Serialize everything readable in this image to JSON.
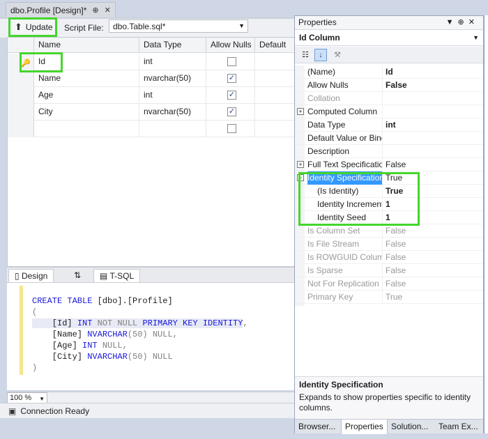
{
  "document_tab": {
    "title": "dbo.Profile [Design]*",
    "pin": "⊕",
    "close": "✕"
  },
  "toolbar": {
    "update_label": "Update",
    "script_file_label": "Script File:",
    "script_file_value": "dbo.Table.sql*"
  },
  "grid": {
    "headers": [
      "Name",
      "Data Type",
      "Allow Nulls",
      "Default"
    ],
    "rows": [
      {
        "name": "Id",
        "type": "int",
        "allow_nulls": false,
        "key": true
      },
      {
        "name": "Name",
        "type": "nvarchar(50)",
        "allow_nulls": true
      },
      {
        "name": "Age",
        "type": "int",
        "allow_nulls": true
      },
      {
        "name": "City",
        "type": "nvarchar(50)",
        "allow_nulls": true
      },
      {
        "name": "",
        "type": "",
        "allow_nulls": false
      }
    ]
  },
  "pane_tabs": {
    "design": "Design",
    "swap": "⇅",
    "tsql": "T-SQL"
  },
  "sql": {
    "l1a": "CREATE TABLE",
    "l1b": " [dbo].[Profile]",
    "l2": "(",
    "l3a": "    [Id] ",
    "l3b": "INT",
    "l3c": " NOT NULL ",
    "l3d": "PRIMARY KEY IDENTITY",
    "l3e": ",",
    "l4a": "    [Name] ",
    "l4b": "NVARCHAR",
    "l4c": "(50) ",
    "l4d": "NULL,",
    "l5a": "    [Age] ",
    "l5b": "INT",
    "l5c": " NULL,",
    "l6a": "    [City] ",
    "l6b": "NVARCHAR",
    "l6c": "(50) ",
    "l6d": "NULL",
    "l7": ")"
  },
  "zoom": "100 %",
  "status": "Connection Ready",
  "properties": {
    "title": "Properties",
    "object": "Id  Column",
    "rows": [
      {
        "name": "(Name)",
        "value": "Id",
        "bold": true
      },
      {
        "name": "Allow Nulls",
        "value": "False",
        "bold": true
      },
      {
        "name": "Collation",
        "value": "",
        "dim": true
      },
      {
        "name": "Computed Column",
        "value": "",
        "expand": "+"
      },
      {
        "name": "Data Type",
        "value": "int",
        "bold": true
      },
      {
        "name": "Default Value or Binding",
        "value": ""
      },
      {
        "name": "Description",
        "value": ""
      },
      {
        "name": "Full Text Specification",
        "value": "False",
        "expand": "+"
      },
      {
        "name": "Identity Specification",
        "value": "True",
        "expand": "−",
        "selected": true
      },
      {
        "name": "(Is Identity)",
        "value": "True",
        "bold": true,
        "indent": true
      },
      {
        "name": "Identity Increment",
        "value": "1",
        "bold": true,
        "indent": true
      },
      {
        "name": "Identity Seed",
        "value": "1",
        "bold": true,
        "indent": true
      },
      {
        "name": "Is Column Set",
        "value": "False",
        "dim": true
      },
      {
        "name": "Is File Stream",
        "value": "False",
        "dim": true
      },
      {
        "name": "Is ROWGUID Column",
        "value": "False",
        "dim": true
      },
      {
        "name": "Is Sparse",
        "value": "False",
        "dim": true
      },
      {
        "name": "Not For Replication",
        "value": "False",
        "dim": true
      },
      {
        "name": "Primary Key",
        "value": "True",
        "dim": true
      }
    ],
    "description_title": "Identity Specification",
    "description_text": "Expands to show properties specific to identity columns.",
    "tabs": [
      "Browser...",
      "Properties",
      "Solution...",
      "Team Ex..."
    ]
  }
}
